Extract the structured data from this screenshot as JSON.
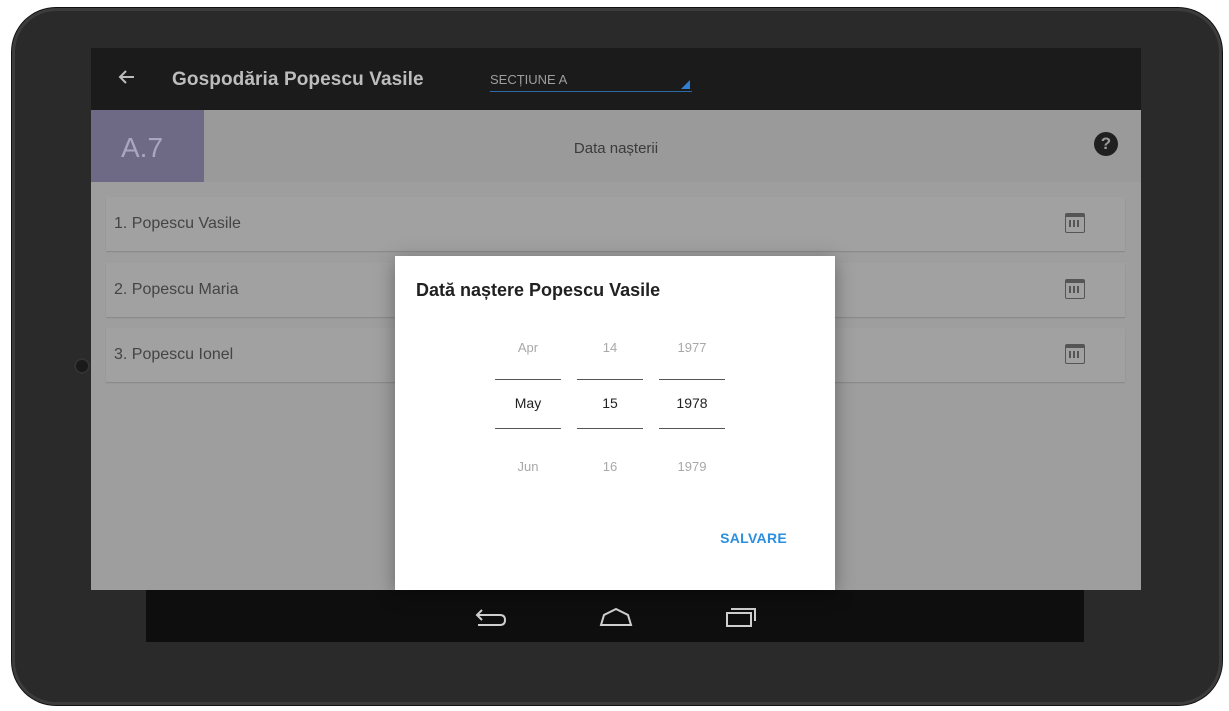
{
  "app": {
    "title": "Gospodăria Popescu Vasile",
    "section_select_value": "SECȚIUNE A"
  },
  "subheader": {
    "code": "A.7",
    "title": "Data nașterii"
  },
  "rows": [
    {
      "label": "1. Popescu Vasile"
    },
    {
      "label": "2. Popescu Maria"
    },
    {
      "label": "3. Popescu Ionel"
    }
  ],
  "dialog": {
    "title": "Dată naștere Popescu Vasile",
    "month": {
      "prev": "Apr",
      "current": "May",
      "next": "Jun"
    },
    "day": {
      "prev": "14",
      "current": "15",
      "next": "16"
    },
    "year": {
      "prev": "1977",
      "current": "1978",
      "next": "1979"
    },
    "save_label": "SALVARE"
  },
  "icons": {
    "back": "arrow-left-icon",
    "help": "help-icon",
    "calendar": "calendar-icon",
    "nav_back": "nav-back-icon",
    "nav_home": "nav-home-icon",
    "nav_recent": "nav-recent-apps-icon"
  },
  "colors": {
    "appbar": "#1b1b1b",
    "accent": "#2a8fe0",
    "code_box": "#6e6a85",
    "overlay_bg": "#9e9e9e"
  }
}
